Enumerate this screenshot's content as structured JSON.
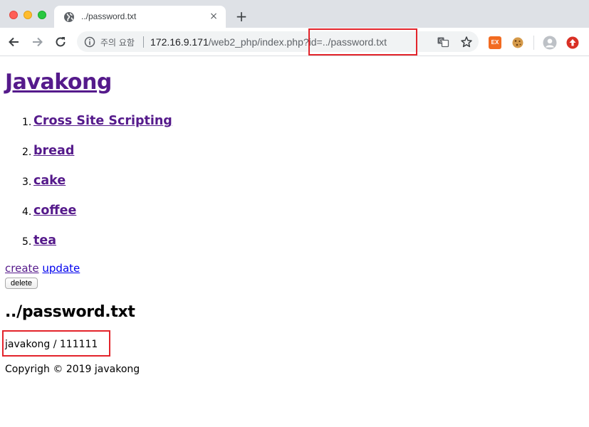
{
  "browser": {
    "tab": {
      "title": "../password.txt"
    },
    "omnibox": {
      "security_label": "주의 요함",
      "url_host": "172.16.9.171",
      "url_path": "/web2_php/index.php?id=../password.txt"
    },
    "icons": {
      "close_tab": "×",
      "new_tab": "+"
    },
    "extension_badge": "EX"
  },
  "page": {
    "site_title": "Javakong",
    "topics": [
      {
        "number": "1.",
        "label": "Cross Site Scripting"
      },
      {
        "number": "2.",
        "label": "bread"
      },
      {
        "number": "3.",
        "label": "cake"
      },
      {
        "number": "4.",
        "label": "coffee"
      },
      {
        "number": "5.",
        "label": "tea"
      }
    ],
    "actions": {
      "create": "create",
      "update": "update",
      "delete": "delete"
    },
    "document": {
      "title": "../password.txt",
      "body": "javakong / 111111"
    },
    "footer": "Copyrigh © 2019 javakong"
  },
  "colors": {
    "visited_link": "#551a8b",
    "link": "#0000ee",
    "highlight": "#e3242b"
  }
}
